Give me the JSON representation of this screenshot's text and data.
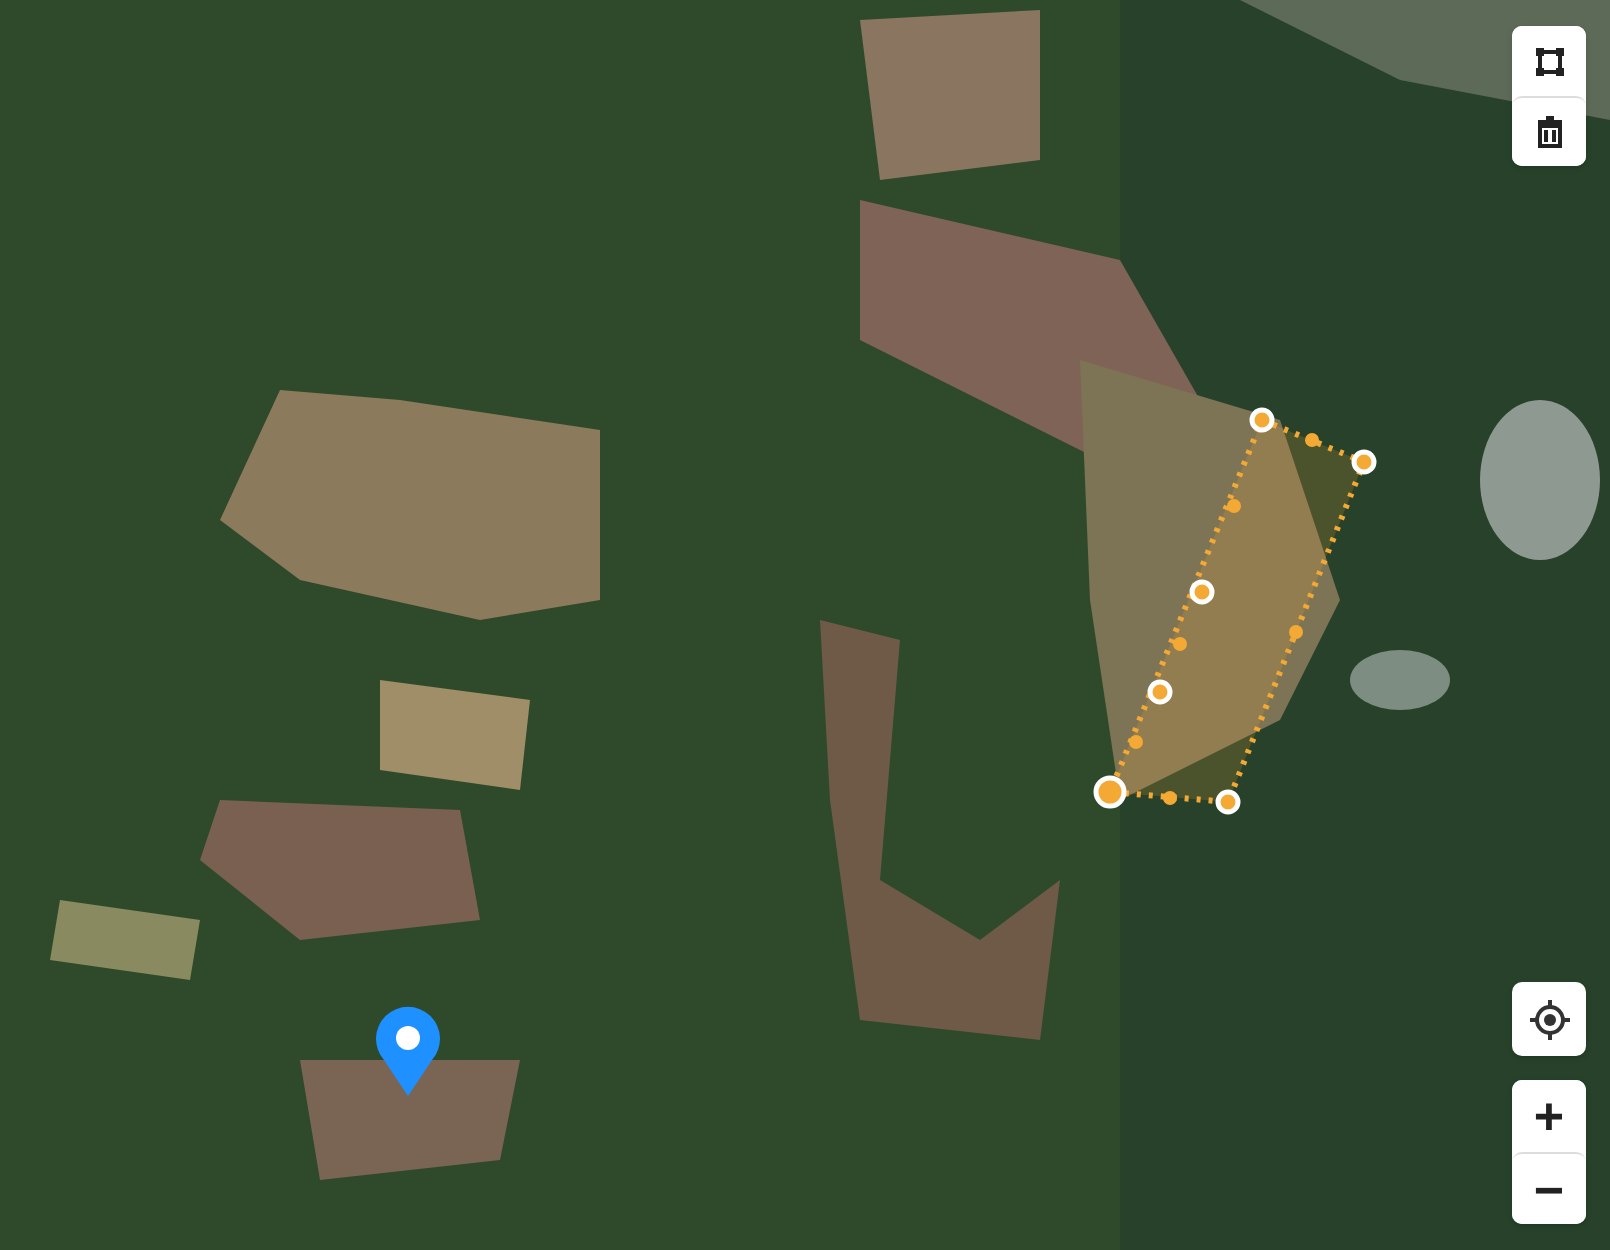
{
  "map": {
    "kind": "satellite"
  },
  "draw_toolbar": {
    "buttons": [
      {
        "kind": "polygon"
      },
      {
        "kind": "trash"
      }
    ]
  },
  "locate_button": {
    "kind": "locate"
  },
  "zoom_controls": {
    "zoom_in": "+",
    "zoom_out": "−"
  }
}
